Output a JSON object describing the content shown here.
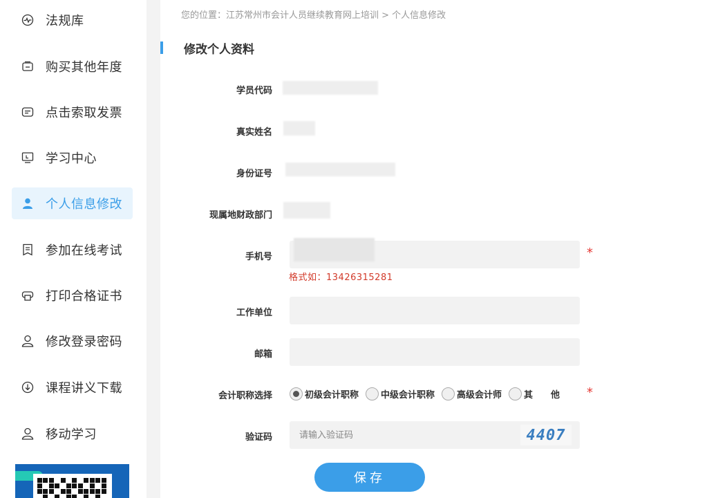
{
  "sidebar": {
    "items": [
      {
        "label": "法规库",
        "icon": "pulse-icon"
      },
      {
        "label": "购买其他年度",
        "icon": "wallet-icon"
      },
      {
        "label": "点击索取发票",
        "icon": "invoice-icon"
      },
      {
        "label": "学习中心",
        "icon": "monitor-icon"
      },
      {
        "label": "个人信息修改",
        "icon": "user-icon",
        "active": true
      },
      {
        "label": "参加在线考试",
        "icon": "exam-icon"
      },
      {
        "label": "打印合格证书",
        "icon": "printer-icon"
      },
      {
        "label": "修改登录密码",
        "icon": "user-icon"
      },
      {
        "label": "课程讲义下载",
        "icon": "download-icon"
      },
      {
        "label": "移动学习",
        "icon": "user-icon"
      }
    ]
  },
  "breadcrumb": "您的位置：江苏常州市会计人员继续教育网上培训 > 个人信息修改",
  "section_title": "修改个人资料",
  "form": {
    "student_code_label": "学员代码",
    "real_name_label": "真实姓名",
    "id_number_label": "身份证号",
    "finance_dept_label": "现属地财政部门",
    "phone_label": "手机号",
    "phone_hint": "格式如：13426315281",
    "employer_label": "工作单位",
    "email_label": "邮箱",
    "title_label": "会计职称选择",
    "title_options": [
      "初级会计职称",
      "中级会计职称",
      "高级会计师",
      "其　　他"
    ],
    "title_selected": "初级会计职称",
    "captcha_label": "验证码",
    "captcha_placeholder": "请输入验证码",
    "captcha_code": "4407",
    "required_mark": "*",
    "save_label": "保存"
  },
  "colors": {
    "accent": "#3b9ee8",
    "error": "#d23a2a",
    "active_bg": "#e8f4fd"
  }
}
